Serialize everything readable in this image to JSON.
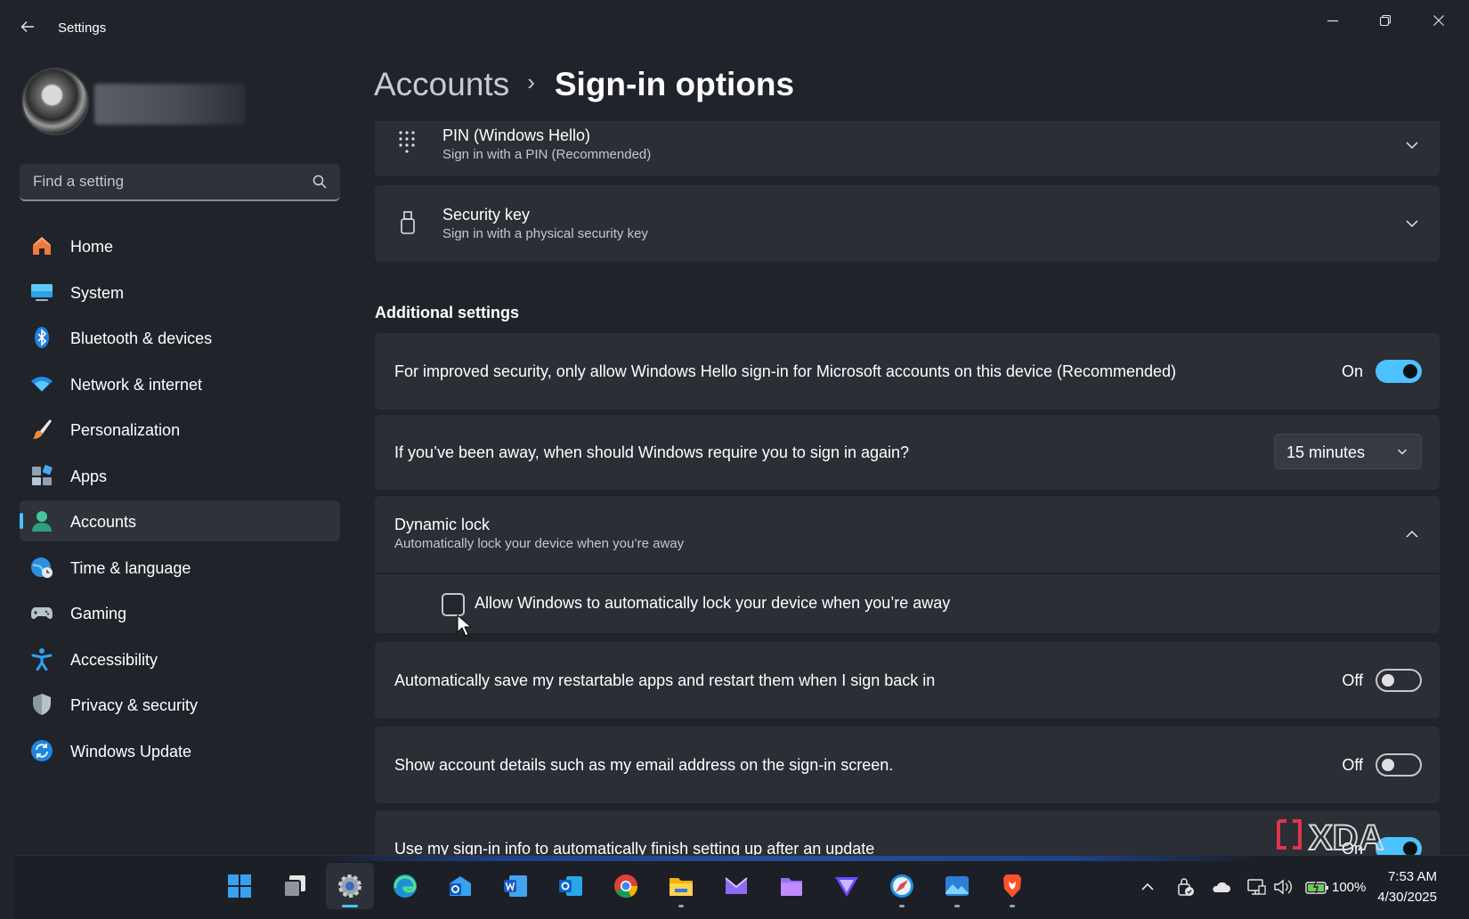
{
  "window": {
    "title": "Settings",
    "accent": "#4cc2ff"
  },
  "sidebar": {
    "search_placeholder": "Find a setting",
    "items": [
      {
        "label": "Home",
        "icon": "home-icon"
      },
      {
        "label": "System",
        "icon": "system-icon"
      },
      {
        "label": "Bluetooth & devices",
        "icon": "bluetooth-icon"
      },
      {
        "label": "Network & internet",
        "icon": "network-icon"
      },
      {
        "label": "Personalization",
        "icon": "brush-icon"
      },
      {
        "label": "Apps",
        "icon": "apps-icon"
      },
      {
        "label": "Accounts",
        "icon": "accounts-icon",
        "active": true
      },
      {
        "label": "Time & language",
        "icon": "globe-clock-icon"
      },
      {
        "label": "Gaming",
        "icon": "gamepad-icon"
      },
      {
        "label": "Accessibility",
        "icon": "accessibility-icon"
      },
      {
        "label": "Privacy & security",
        "icon": "shield-icon"
      },
      {
        "label": "Windows Update",
        "icon": "update-icon"
      }
    ]
  },
  "breadcrumb": {
    "parent": "Accounts",
    "separator": "›",
    "current": "Sign-in options"
  },
  "ways_to_sign_in": [
    {
      "title": "PIN (Windows Hello)",
      "subtitle": "Sign in with a PIN (Recommended)",
      "icon": "keypad-icon"
    },
    {
      "title": "Security key",
      "subtitle": "Sign in with a physical security key",
      "icon": "usb-key-icon"
    }
  ],
  "additional": {
    "heading": "Additional settings",
    "hello_only": {
      "text": "For improved security, only allow Windows Hello sign-in for Microsoft accounts on this device (Recommended)",
      "state": "On"
    },
    "require_signin": {
      "text": "If you’ve been away, when should Windows require you to sign in again?",
      "selected": "15 minutes"
    },
    "dynamic_lock": {
      "title": "Dynamic lock",
      "subtitle": "Automatically lock your device when you’re away",
      "checkbox_label": "Allow Windows to automatically lock your device when you’re away",
      "checked": false
    },
    "restart_apps": {
      "text": "Automatically save my restartable apps and restart them when I sign back in",
      "state": "Off"
    },
    "account_details": {
      "text": "Show account details such as my email address on the sign-in screen.",
      "state": "Off"
    },
    "finish_setup": {
      "text": "Use my sign-in info to automatically finish setting up after an update",
      "state": "On"
    }
  },
  "watermark": "XDA",
  "taskbar": {
    "apps": [
      "windows-start-icon",
      "task-view-icon",
      "settings-icon",
      "edge-icon",
      "outlook-new-icon",
      "word-icon",
      "outlook-icon",
      "chrome-icon",
      "file-explorer-icon",
      "proton-mail-icon",
      "files-icon",
      "proton-vpn-icon",
      "safari-like-icon",
      "photos-icon",
      "brave-icon"
    ],
    "battery": "100%",
    "time": "7:53 AM",
    "date": "4/30/2025"
  }
}
